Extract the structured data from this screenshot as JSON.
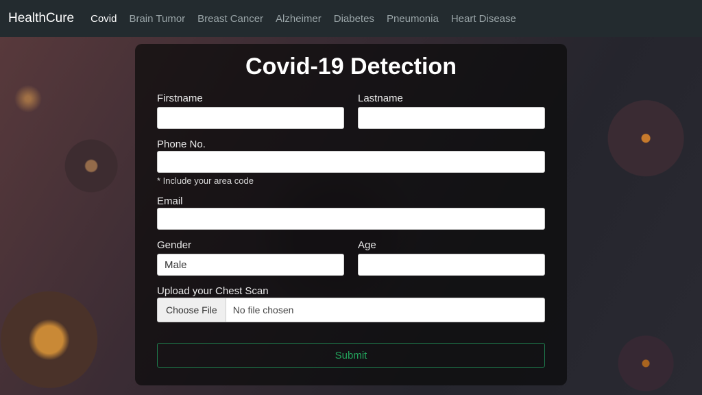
{
  "nav": {
    "brand": "HealthCure",
    "links": [
      "Covid",
      "Brain Tumor",
      "Breast Cancer",
      "Alzheimer",
      "Diabetes",
      "Pneumonia",
      "Heart Disease"
    ],
    "active_index": 0
  },
  "card": {
    "title": "Covid-19 Detection",
    "labels": {
      "firstname": "Firstname",
      "lastname": "Lastname",
      "phone": "Phone No.",
      "phone_hint": "* Include your area code",
      "email": "Email",
      "gender": "Gender",
      "age": "Age",
      "upload": "Upload your Chest Scan"
    },
    "gender_value": "Male",
    "file": {
      "button": "Choose File",
      "status": "No file chosen"
    },
    "submit": "Submit"
  }
}
